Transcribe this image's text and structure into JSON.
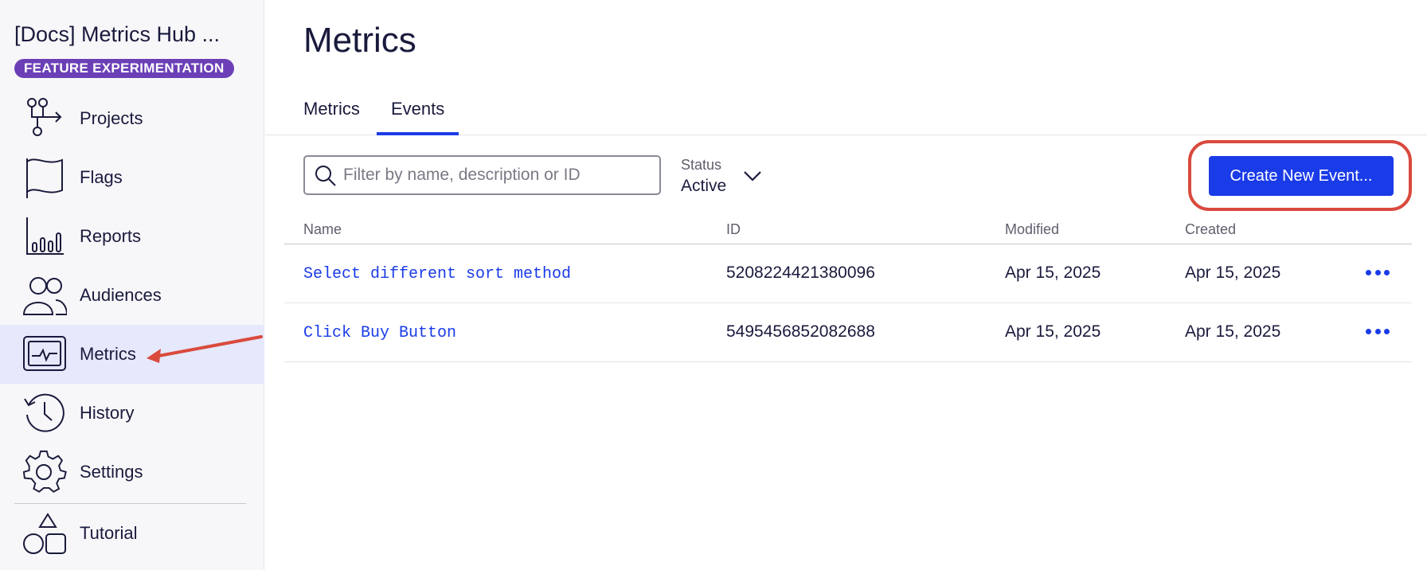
{
  "sidebar": {
    "project_title": "[Docs] Metrics Hub ...",
    "badge": "FEATURE EXPERIMENTATION",
    "items": [
      {
        "label": "Projects",
        "icon": "projects-icon"
      },
      {
        "label": "Flags",
        "icon": "flag-icon"
      },
      {
        "label": "Reports",
        "icon": "reports-icon"
      },
      {
        "label": "Audiences",
        "icon": "audiences-icon"
      },
      {
        "label": "Metrics",
        "icon": "metrics-icon",
        "active": true
      },
      {
        "label": "History",
        "icon": "history-icon"
      },
      {
        "label": "Settings",
        "icon": "gear-icon"
      }
    ],
    "tutorial_label": "Tutorial"
  },
  "main": {
    "title": "Metrics",
    "tabs": [
      {
        "label": "Metrics"
      },
      {
        "label": "Events",
        "active": true
      }
    ],
    "search": {
      "placeholder": "Filter by name, description or ID"
    },
    "status": {
      "label": "Status",
      "value": "Active"
    },
    "create_button": "Create New Event..."
  },
  "table": {
    "columns": [
      "Name",
      "ID",
      "Modified",
      "Created"
    ],
    "rows": [
      {
        "name": "Select different sort method",
        "id": "5208224421380096",
        "modified": "Apr 15, 2025",
        "created": "Apr 15, 2025"
      },
      {
        "name": "Click Buy Button",
        "id": "5495456852082688",
        "modified": "Apr 15, 2025",
        "created": "Apr 15, 2025"
      }
    ]
  },
  "colors": {
    "accent": "#1a3be8",
    "badge": "#6b3fb6",
    "annotation": "#d94a3d",
    "active_nav": "#e6e8fb"
  }
}
